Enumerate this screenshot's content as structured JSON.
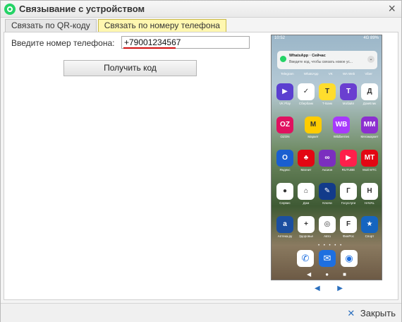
{
  "window": {
    "title": "Связывание с устройством",
    "close_glyph": "×"
  },
  "tabs": [
    {
      "label": "Связать по QR-коду",
      "active": false
    },
    {
      "label": "Связать по номеру телефона",
      "active": true
    }
  ],
  "form": {
    "phone_label": "Введите номер телефона:",
    "phone_value": "+79001234567",
    "get_code_label": "Получить код"
  },
  "phone_screen": {
    "status_time": "10:52",
    "status_right": "4G 89%",
    "notification": {
      "app": "WhatsApp · Сейчас",
      "body": "Введите код, чтобы связать новое ус...",
      "chevron": "⌄"
    },
    "top_labels": [
      "Telegram",
      "WhatsApp",
      "VK",
      "WA Web",
      "Viber"
    ],
    "apps": [
      [
        {
          "label": "VK Play",
          "color": "#5b3fd0",
          "glyph": "▶"
        },
        {
          "label": "Сбербанк",
          "color": "#ffffff",
          "glyph": "✓"
        },
        {
          "label": "Т-Банк",
          "color": "#ffdd2d",
          "glyph": "T"
        },
        {
          "label": "Мобайл",
          "color": "#6a3fd0",
          "glyph": "T"
        },
        {
          "label": "ДомКлик",
          "color": "#ffffff",
          "glyph": "Д"
        }
      ],
      [
        {
          "label": "OZON",
          "color": "#e0115f",
          "glyph": "OZ"
        },
        {
          "label": "Маркет",
          "color": "#ffcc00",
          "glyph": "M"
        },
        {
          "label": "Wildberries",
          "color": "#a73afd",
          "glyph": "WB"
        },
        {
          "label": "Мегамаркет",
          "color": "#8c2fd0",
          "glyph": "ММ"
        }
      ],
      [
        {
          "label": "Яндекс",
          "color": "#1a5fd0",
          "glyph": "O"
        },
        {
          "label": "Магнит",
          "color": "#e30613",
          "glyph": "♣"
        },
        {
          "label": "Аксион",
          "color": "#7b2fbf",
          "glyph": "∞"
        },
        {
          "label": "RUTUBE",
          "color": "#ff1f4b",
          "glyph": "▶"
        },
        {
          "label": "Мой МТС",
          "color": "#e30613",
          "glyph": "МТ"
        }
      ],
      [
        {
          "label": "Сервис",
          "color": "#ffffff",
          "glyph": "●"
        },
        {
          "label": "Дом",
          "color": "#ffffff",
          "glyph": "⌂"
        },
        {
          "label": "Ключи",
          "color": "#123b8a",
          "glyph": "✎"
        },
        {
          "label": "Госуслуги",
          "color": "#ffffff",
          "glyph": "Г"
        },
        {
          "label": "HAVAL",
          "color": "#ffffff",
          "glyph": "H"
        }
      ],
      [
        {
          "label": "Аптека.ру",
          "color": "#1b4fa0",
          "glyph": "a"
        },
        {
          "label": "Здоровье",
          "color": "#ffffff",
          "glyph": "+"
        },
        {
          "label": "Авто",
          "color": "#ffffff",
          "glyph": "◎"
        },
        {
          "label": "ФинРос",
          "color": "#ffffff",
          "glyph": "F"
        },
        {
          "label": "Спорт",
          "color": "#1565c0",
          "glyph": "★"
        }
      ]
    ],
    "dock": [
      {
        "name": "phone-app-icon",
        "color": "#ffffff",
        "glyph": "✆"
      },
      {
        "name": "messages-app-icon",
        "color": "#1e6fe0",
        "glyph": "✉"
      },
      {
        "name": "camera-app-icon",
        "color": "#ffffff",
        "glyph": "◉"
      }
    ],
    "page_dots": "• • • • •",
    "nav": [
      "◀",
      "●",
      "■"
    ]
  },
  "pager": {
    "prev": "◀",
    "next": "▶"
  },
  "footer": {
    "close_label": "Закрыть",
    "close_glyph": "✕"
  }
}
